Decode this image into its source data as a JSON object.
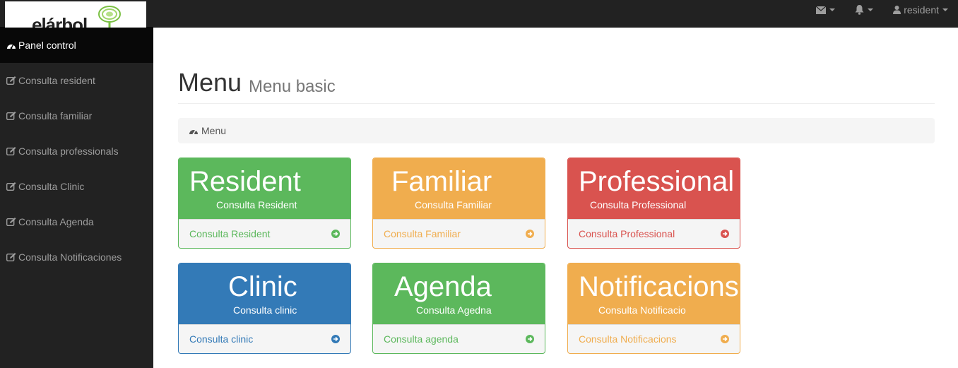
{
  "brand": {
    "logo_text": "elárbol"
  },
  "navbar": {
    "mail_icon": "envelope-icon",
    "bell_icon": "bell-icon",
    "user_label": "resident"
  },
  "sidebar": {
    "items": [
      {
        "label": "Panel control",
        "icon": "dashboard-icon",
        "active": true
      },
      {
        "label": "Consulta resident",
        "icon": "edit-icon"
      },
      {
        "label": "Consulta familiar",
        "icon": "edit-icon"
      },
      {
        "label": "Consulta professionals",
        "icon": "edit-icon"
      },
      {
        "label": "Consulta Clinic",
        "icon": "edit-icon"
      },
      {
        "label": "Consulta Agenda",
        "icon": "edit-icon"
      },
      {
        "label": "Consulta Notificaciones",
        "icon": "edit-icon"
      }
    ]
  },
  "header": {
    "title": "Menu",
    "subtitle": "Menu basic"
  },
  "breadcrumb": {
    "label": "Menu"
  },
  "colors": {
    "green": "#5cb85c",
    "orange": "#f0ad4e",
    "red": "#d9534f",
    "blue": "#337ab7"
  },
  "panels": [
    {
      "title": "Resident",
      "subtitle": "Consulta Resident",
      "link": "Consulta Resident"
    },
    {
      "title": "Familiar",
      "subtitle": "Consulta Familiar",
      "link": "Consulta Familiar"
    },
    {
      "title": "Professional",
      "subtitle": "Consulta Professional",
      "link": "Consulta Professional"
    },
    {
      "title": "Clinic",
      "subtitle": "Consulta clinic",
      "link": "Consulta clinic"
    },
    {
      "title": "Agenda",
      "subtitle": "Consulta Agedna",
      "link": "Consulta agenda"
    },
    {
      "title": "Notificacions",
      "subtitle": "Consulta Notificacio",
      "link": "Consulta Notificacions"
    }
  ]
}
